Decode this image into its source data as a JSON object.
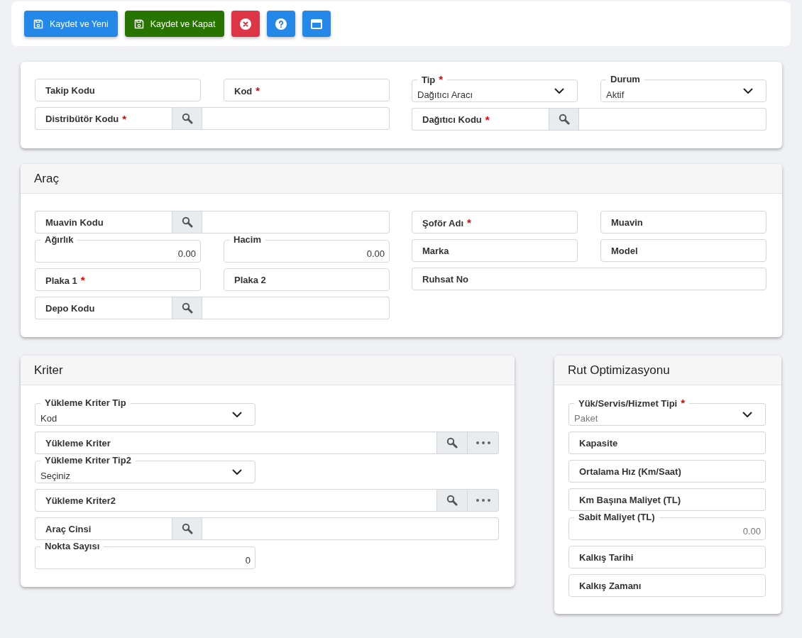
{
  "required_mark": "*",
  "toolbar": {
    "buttons": [
      {
        "kind": "save",
        "label": "Kaydet ve Yeni"
      },
      {
        "kind": "save-close",
        "label": "Kaydet ve Kapat"
      },
      {
        "kind": "cancel"
      },
      {
        "kind": "help"
      },
      {
        "kind": "window"
      }
    ]
  },
  "cards": [
    {
      "kind": "wide",
      "panels": [
        {
          "fields": [
            {
              "kind": "text",
              "label": "Takip Kodu",
              "required": false
            },
            {
              "kind": "text",
              "label": "Kod",
              "required": true
            },
            {
              "kind": "lookup",
              "label": "Distribütör Kodu",
              "required": true
            }
          ]
        },
        {
          "fields": [
            {
              "kind": "select",
              "label": "Tip",
              "required": true,
              "value": "Dağıtıcı Aracı"
            },
            {
              "kind": "select",
              "label": "Durum",
              "required": false,
              "value": "Aktif"
            },
            {
              "kind": "lookup",
              "label": "Dağıtıcı Kodu",
              "required": true
            }
          ]
        }
      ]
    },
    {
      "kind": "wide",
      "title": "Araç",
      "panels": [
        {
          "fields": [
            {
              "kind": "lookup",
              "label": "Muavin Kodu",
              "required": false
            },
            {
              "kind": "number",
              "label": "Ağırlık",
              "required": false,
              "value": "0.00"
            },
            {
              "kind": "number",
              "label": "Hacim",
              "required": false,
              "value": "0.00"
            },
            {
              "kind": "text",
              "label": "Plaka 1",
              "required": true
            },
            {
              "kind": "text",
              "label": "Plaka 2",
              "required": false
            },
            {
              "kind": "lookup",
              "label": "Depo Kodu",
              "required": false
            }
          ]
        },
        {
          "fields": [
            {
              "kind": "text",
              "label": "Şoför Adı",
              "required": true
            },
            {
              "kind": "text",
              "label": "Muavin",
              "required": false
            },
            {
              "kind": "text",
              "label": "Marka",
              "required": false
            },
            {
              "kind": "text",
              "label": "Model",
              "required": false
            },
            {
              "kind": "text",
              "label": "Ruhsat No",
              "required": false
            }
          ]
        }
      ]
    },
    {
      "kind": "half",
      "title": "Kriter",
      "panels": [
        {
          "fields": [
            {
              "kind": "select",
              "label": "Yükleme Kriter Tip",
              "required": false,
              "value": "Kod"
            },
            {
              "kind": "lookup-more",
              "label": "Yükleme Kriter",
              "required": false
            },
            {
              "kind": "select",
              "label": "Yükleme Kriter Tip2",
              "required": false,
              "value": "Seçiniz"
            },
            {
              "kind": "lookup-more",
              "label": "Yükleme Kriter2",
              "required": false
            },
            {
              "kind": "lookup",
              "label": "Araç Cinsi",
              "required": false
            },
            {
              "kind": "number",
              "label": "Nokta Sayısı",
              "required": false,
              "value": "0"
            }
          ]
        }
      ]
    },
    {
      "kind": "narrow",
      "title": "Rut Optimizasyonu",
      "panels": [
        {
          "fields": [
            {
              "kind": "select",
              "label": "Yük/Servis/Hizmet Tipi",
              "required": true,
              "placeholder": "Paket"
            },
            {
              "kind": "text",
              "label": "Kapasite",
              "required": false
            },
            {
              "kind": "text",
              "label": "Ortalama Hız (Km/Saat)",
              "required": false
            },
            {
              "kind": "text",
              "label": "Km Başına Maliyet (TL)",
              "required": false
            },
            {
              "kind": "number",
              "label": "Sabit Maliyet (TL)",
              "required": false,
              "placeholder": "0.00"
            },
            {
              "kind": "text",
              "label": "Kalkış Tarihi",
              "required": false
            },
            {
              "kind": "text",
              "label": "Kalkış Zamanı",
              "required": false
            }
          ]
        }
      ]
    }
  ]
}
